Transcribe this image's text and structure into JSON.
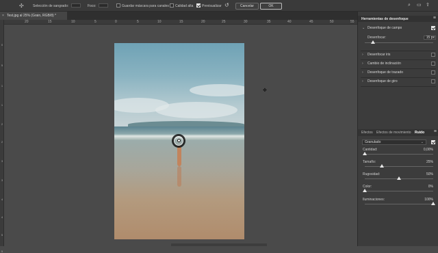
{
  "options_bar": {
    "tool_icon": "blur-gallery-pin-icon",
    "bleed_label": "Selección de sangrado:",
    "focus_label": "Foco:",
    "save_mask_label": "Guardar máscara para canales",
    "save_mask_checked": false,
    "high_quality_label": "Calidad alta",
    "high_quality_checked": false,
    "preview_label": "Previsualizar",
    "preview_checked": true,
    "reset_icon": "reset-arrow-icon",
    "cancel_label": "Cancelar",
    "ok_label": "OK",
    "right_icons": [
      "search-icon",
      "workspace-icon",
      "share-icon"
    ]
  },
  "document_tab": {
    "close": "×",
    "title": "Test.jpg al 25% (Grain, RGB/8) *"
  },
  "ruler": {
    "top_ticks": [
      "20",
      "15",
      "10",
      "5",
      "0",
      "5",
      "10",
      "15",
      "20",
      "25",
      "30",
      "35",
      "40",
      "45",
      "50",
      "55"
    ],
    "left_ticks": [
      "0",
      "5",
      "1",
      "1",
      "2",
      "2",
      "3",
      "3",
      "4",
      "4",
      "5",
      "5"
    ]
  },
  "blur_tools": {
    "title": "Herramientas de desenfoque",
    "menu": "≡",
    "field_blur": {
      "label": "Desenfoque de campo",
      "checked": true,
      "expanded": true
    },
    "blur_param": {
      "label": "Desenfocar:",
      "value": "15 px",
      "level": 0.15
    },
    "items": [
      {
        "label": "Desenfocar iris",
        "checked": false
      },
      {
        "label": "Cambio de inclinación",
        "checked": false
      },
      {
        "label": "Desenfoque de trazado",
        "checked": false
      },
      {
        "label": "Desenfoque de giro",
        "checked": false
      }
    ]
  },
  "effects_panel": {
    "tabs": [
      "Efectos",
      "Efectos de movimiento",
      "Ruido"
    ],
    "active_tab": "Ruido",
    "menu": "≡",
    "noise_type": "Granulado",
    "noise_enabled": true,
    "params": [
      {
        "label": "Cantidad:",
        "value": "0,00%",
        "level": 0.0
      },
      {
        "label": "Tamaño:",
        "value": "25%",
        "level": 0.25
      },
      {
        "label": "Rugosidad:",
        "value": "50%",
        "level": 0.5
      },
      {
        "label": "Color:",
        "value": "0%",
        "level": 0.0
      },
      {
        "label": "Iluminaciones:",
        "value": "100%",
        "level": 1.0
      }
    ]
  },
  "canvas": {
    "pin_icon": "focus-pin-icon",
    "cursor_icon": "pin-cursor-icon"
  }
}
